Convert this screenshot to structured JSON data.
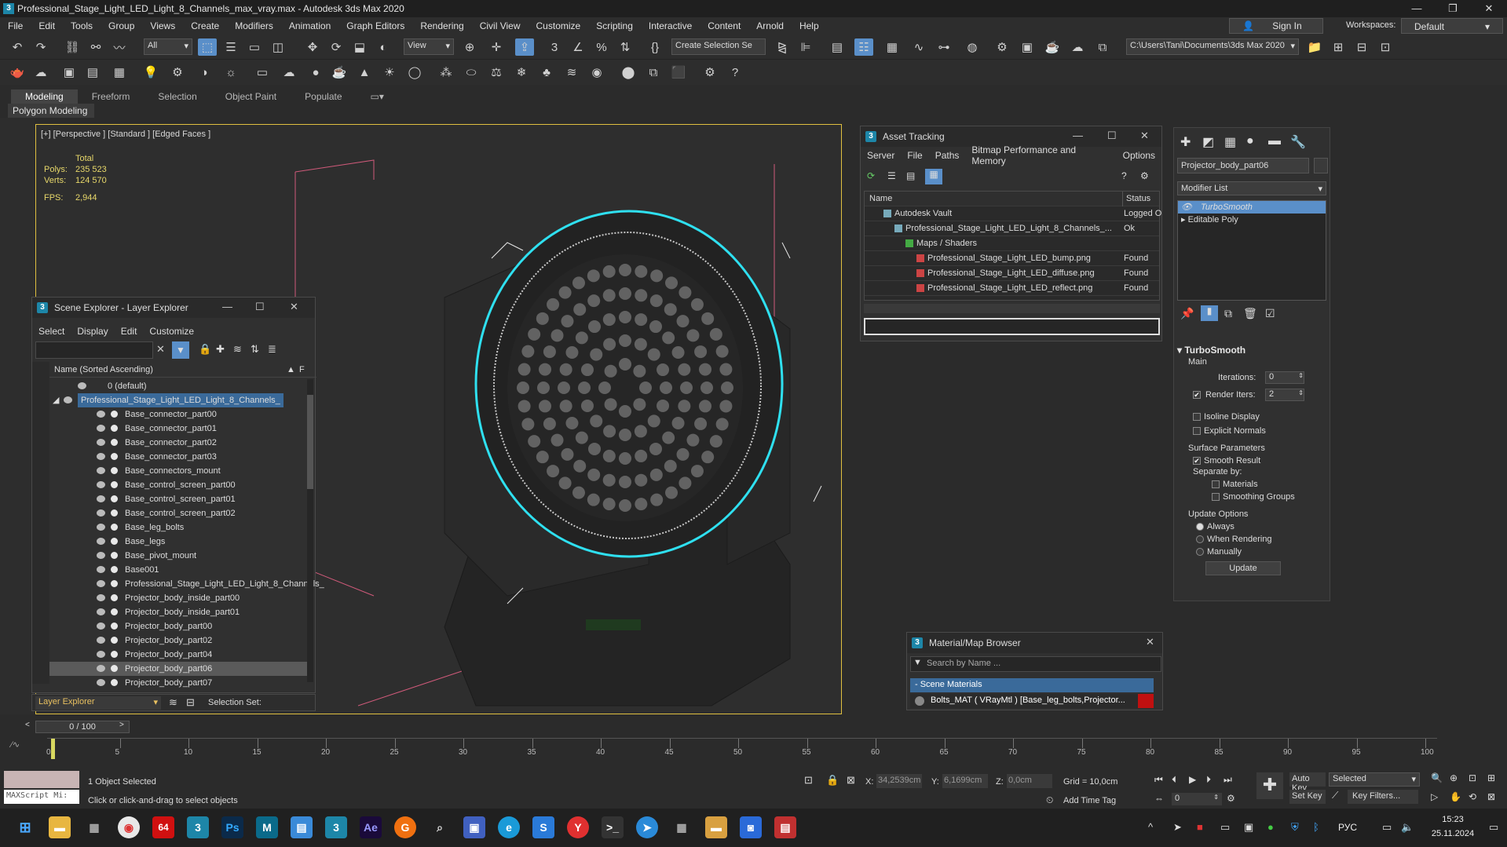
{
  "window": {
    "title": "Professional_Stage_Light_LED_Light_8_Channels_max_vray.max - Autodesk 3ds Max 2020"
  },
  "menu": [
    "File",
    "Edit",
    "Tools",
    "Group",
    "Views",
    "Create",
    "Modifiers",
    "Animation",
    "Graph Editors",
    "Rendering",
    "Civil View",
    "Customize",
    "Scripting",
    "Interactive",
    "Content",
    "Arnold",
    "Help"
  ],
  "account": {
    "sign_in": "Sign In",
    "workspaces_label": "Workspaces:",
    "workspace": "Default"
  },
  "toolbar": {
    "filter": "All",
    "refcoord": "View",
    "selection_set": "Create Selection Se",
    "project_path": "C:\\Users\\Tani\\Documents\\3ds Max 2020"
  },
  "ribbon": {
    "tabs": [
      "Modeling",
      "Freeform",
      "Selection",
      "Object Paint",
      "Populate"
    ],
    "sub": "Polygon Modeling"
  },
  "viewport": {
    "label": "[+] [Perspective ] [Standard ] [Edged Faces ]",
    "total_label": "Total",
    "polys_label": "Polys:",
    "polys": "235 523",
    "verts_label": "Verts:",
    "verts": "124 570",
    "fps_label": "FPS:",
    "fps": "2,944"
  },
  "scene_explorer": {
    "title": "Scene Explorer - Layer Explorer",
    "menu": [
      "Select",
      "Display",
      "Edit",
      "Customize"
    ],
    "column": "Name (Sorted Ascending)",
    "column_f": "F",
    "layers": [
      {
        "name": "0 (default)",
        "indent": 0
      },
      {
        "name": "Professional_Stage_Light_LED_Light_8_Channels_",
        "indent": 0
      }
    ],
    "objects": [
      "Base_connector_part00",
      "Base_connector_part01",
      "Base_connector_part02",
      "Base_connector_part03",
      "Base_connectors_mount",
      "Base_control_screen_part00",
      "Base_control_screen_part01",
      "Base_control_screen_part02",
      "Base_leg_bolts",
      "Base_legs",
      "Base_pivot_mount",
      "Base001",
      "Professional_Stage_Light_LED_Light_8_Channels_",
      "Projector_body_inside_part00",
      "Projector_body_inside_part01",
      "Projector_body_part00",
      "Projector_body_part02",
      "Projector_body_part04",
      "Projector_body_part06",
      "Projector_body_part07"
    ],
    "selected_object": "Projector_body_part06",
    "footer_layer": "Layer Explorer",
    "footer_selset": "Selection Set:"
  },
  "asset_tracking": {
    "title": "Asset Tracking",
    "menu": [
      "Server",
      "File",
      "Paths",
      "Bitmap Performance and Memory",
      "Options"
    ],
    "col_name": "Name",
    "col_status": "Status",
    "rows": [
      {
        "name": "Autodesk Vault",
        "status": "Logged O",
        "level": 1
      },
      {
        "name": "Professional_Stage_Light_LED_Light_8_Channels_...",
        "status": "Ok",
        "level": 2
      },
      {
        "name": "Maps / Shaders",
        "status": "",
        "level": 3
      },
      {
        "name": "Professional_Stage_Light_LED_bump.png",
        "status": "Found",
        "level": 4
      },
      {
        "name": "Professional_Stage_Light_LED_diffuse.png",
        "status": "Found",
        "level": 4
      },
      {
        "name": "Professional_Stage_Light_LED_reflect.png",
        "status": "Found",
        "level": 4
      }
    ]
  },
  "material_browser": {
    "title": "Material/Map Browser",
    "search_placeholder": "Search by Name ...",
    "section": "- Scene Materials",
    "item": "Bolts_MAT ( VRayMtl ) [Base_leg_bolts,Projector..."
  },
  "command_panel": {
    "object_name": "Projector_body_part06",
    "modifier_list": "Modifier List",
    "stack": [
      "TurboSmooth",
      "Editable Poly"
    ],
    "turbosmooth": {
      "title": "TurboSmooth",
      "main": "Main",
      "iterations_label": "Iterations:",
      "iterations": "0",
      "render_iters_label": "Render Iters:",
      "render_iters": "2",
      "isoline": "Isoline Display",
      "explicit": "Explicit Normals",
      "surface": "Surface Parameters",
      "smooth": "Smooth Result",
      "separate": "Separate by:",
      "materials": "Materials",
      "smoothing": "Smoothing Groups",
      "update_opts": "Update Options",
      "always": "Always",
      "when_rendering": "When Rendering",
      "manually": "Manually",
      "update_btn": "Update"
    }
  },
  "timeline": {
    "frame": "0 / 100",
    "ticks": [
      "0",
      "5",
      "10",
      "15",
      "20",
      "25",
      "30",
      "35",
      "40",
      "45",
      "50",
      "55",
      "60",
      "65",
      "70",
      "75",
      "80",
      "85",
      "90",
      "95",
      "100"
    ]
  },
  "status": {
    "maxscript": "MAXScript Mi:",
    "selected": "1 Object Selected",
    "prompt": "Click or click-and-drag to select objects",
    "x_label": "X:",
    "x": "34,2539cm",
    "y_label": "Y:",
    "y": "6,1699cm",
    "z_label": "Z:",
    "z": "0,0cm",
    "grid": "Grid = 10,0cm",
    "add_time_tag": "Add Time Tag",
    "auto_key": "Auto Key",
    "selected_dd": "Selected",
    "set_key": "Set Key",
    "key_filters": "Key Filters...",
    "frame_field": "0"
  },
  "taskbar": {
    "lang": "РУС",
    "time": "15:23",
    "date": "25.11.2024",
    "badge": "64"
  }
}
